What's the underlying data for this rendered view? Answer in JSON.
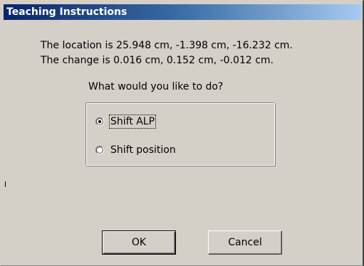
{
  "window": {
    "title": "Teaching Instructions"
  },
  "message": {
    "line1": "The location is 25.948 cm, -1.398 cm, -16.232 cm.",
    "line2": "The change is 0.016 cm, 0.152 cm, -0.012 cm."
  },
  "prompt": {
    "question": "What would you like to do?"
  },
  "options": [
    {
      "label": "Shift ALP",
      "selected": true
    },
    {
      "label": "Shift position",
      "selected": false
    }
  ],
  "buttons": {
    "ok_label": "OK",
    "cancel_label": "Cancel"
  },
  "colors": {
    "dialog_background": "#d4d0c8",
    "titlebar_start": "#0a246a",
    "titlebar_end": "#a6caf0",
    "title_text": "#ffffff"
  }
}
